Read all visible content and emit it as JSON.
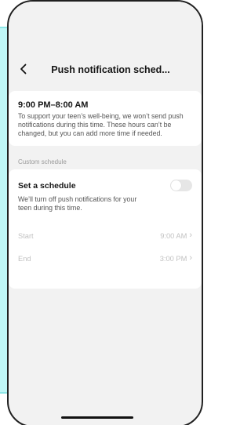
{
  "header": {
    "title": "Push notification sched..."
  },
  "info": {
    "title": "9:00 PM–8:00 AM",
    "body": "To support your teen’s well-being, we won’t send push notifications during this time. These hours can’t be changed, but you can add more time if needed."
  },
  "custom": {
    "section_label": "Custom schedule",
    "title": "Set a schedule",
    "description": "We’ll turn off push notifications for your teen during this time.",
    "enabled": false,
    "start_label": "Start",
    "start_value": "9:00 AM",
    "end_label": "End",
    "end_value": "3:00 PM"
  },
  "icons": {
    "back": "chevron-left-icon",
    "arrow": "chevron-right-icon"
  },
  "colors": {
    "side_panel": "#bff6f6",
    "background": "#f2f2f2",
    "card": "#ffffff",
    "disabled_text": "#c2c2c2",
    "toggle_off": "#e6e6e6"
  }
}
